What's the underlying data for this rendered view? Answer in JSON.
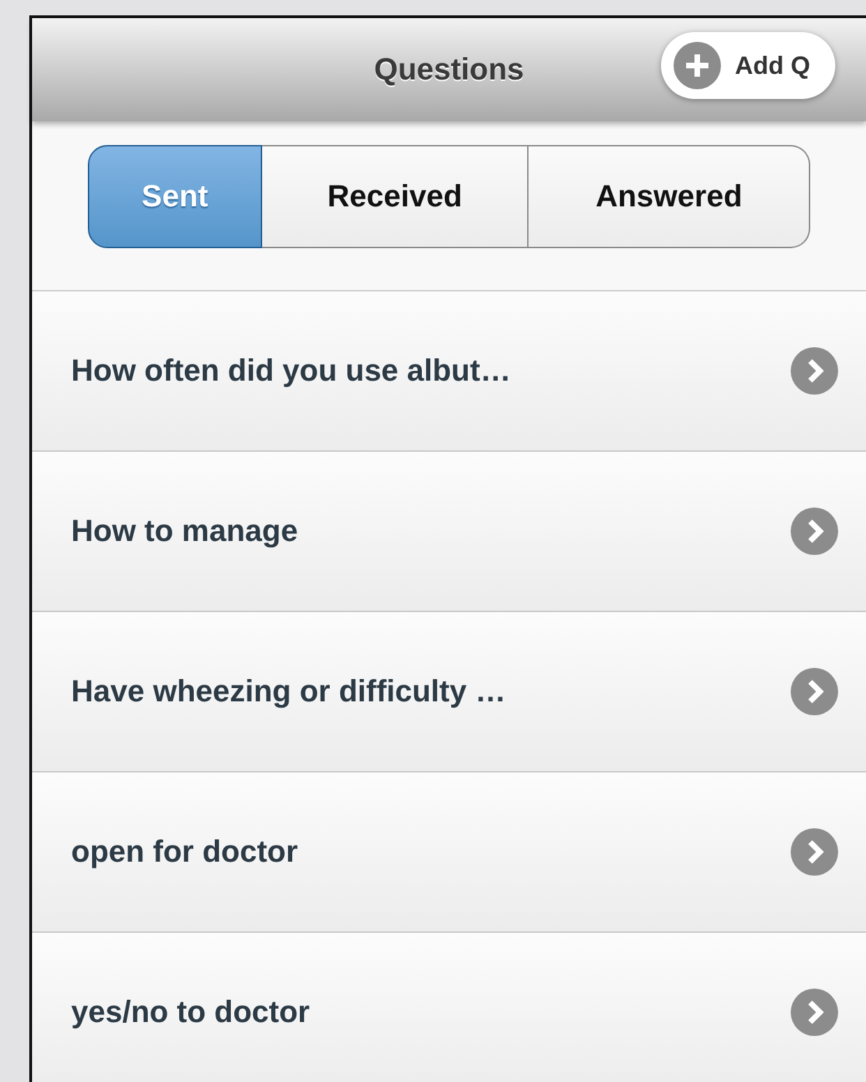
{
  "header": {
    "title": "Questions",
    "add_button": "Add Q"
  },
  "tabs": [
    {
      "label": "Sent",
      "selected": true
    },
    {
      "label": "Received",
      "selected": false
    },
    {
      "label": "Answered",
      "selected": false
    }
  ],
  "questions": [
    {
      "text": "How often did you use albut…"
    },
    {
      "text": "How to manage"
    },
    {
      "text": "Have wheezing or difficulty …"
    },
    {
      "text": "open for doctor"
    },
    {
      "text": "yes/no to doctor"
    }
  ]
}
